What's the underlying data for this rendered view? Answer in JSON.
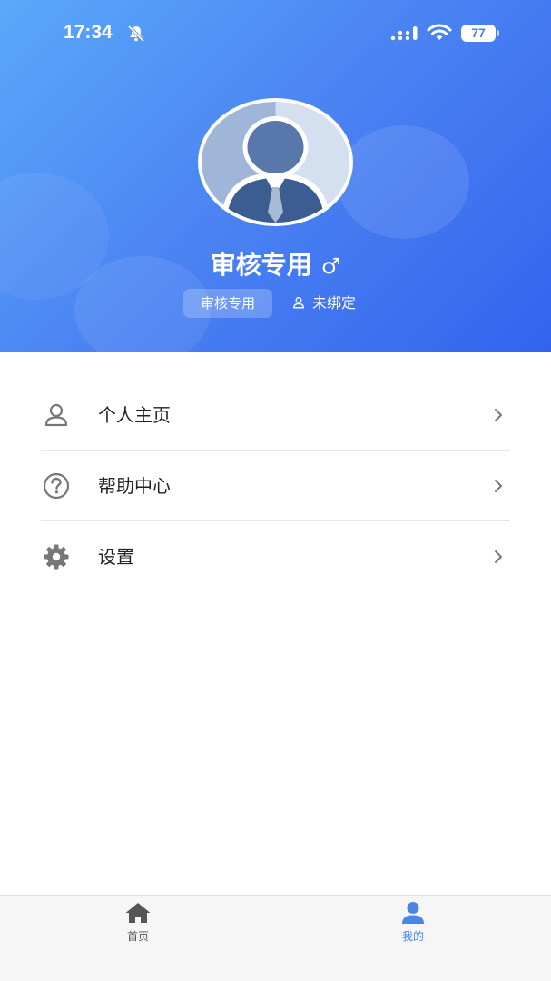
{
  "status_bar": {
    "time": "17:34",
    "battery": "77"
  },
  "profile": {
    "name": "审核专用",
    "gender_symbol": "♂",
    "tag": "审核专用",
    "binding_status": "未绑定"
  },
  "menu": {
    "items": [
      {
        "label": "个人主页",
        "icon": "person-icon"
      },
      {
        "label": "帮助中心",
        "icon": "help-icon"
      },
      {
        "label": "设置",
        "icon": "gear-icon"
      }
    ]
  },
  "tabbar": {
    "items": [
      {
        "label": "首页",
        "icon": "home-icon",
        "active": false
      },
      {
        "label": "我的",
        "icon": "user-icon",
        "active": true
      }
    ]
  },
  "colors": {
    "header_gradient_start": "#5aa8fb",
    "header_gradient_end": "#3363ee",
    "active_tab": "#4a86e8"
  }
}
